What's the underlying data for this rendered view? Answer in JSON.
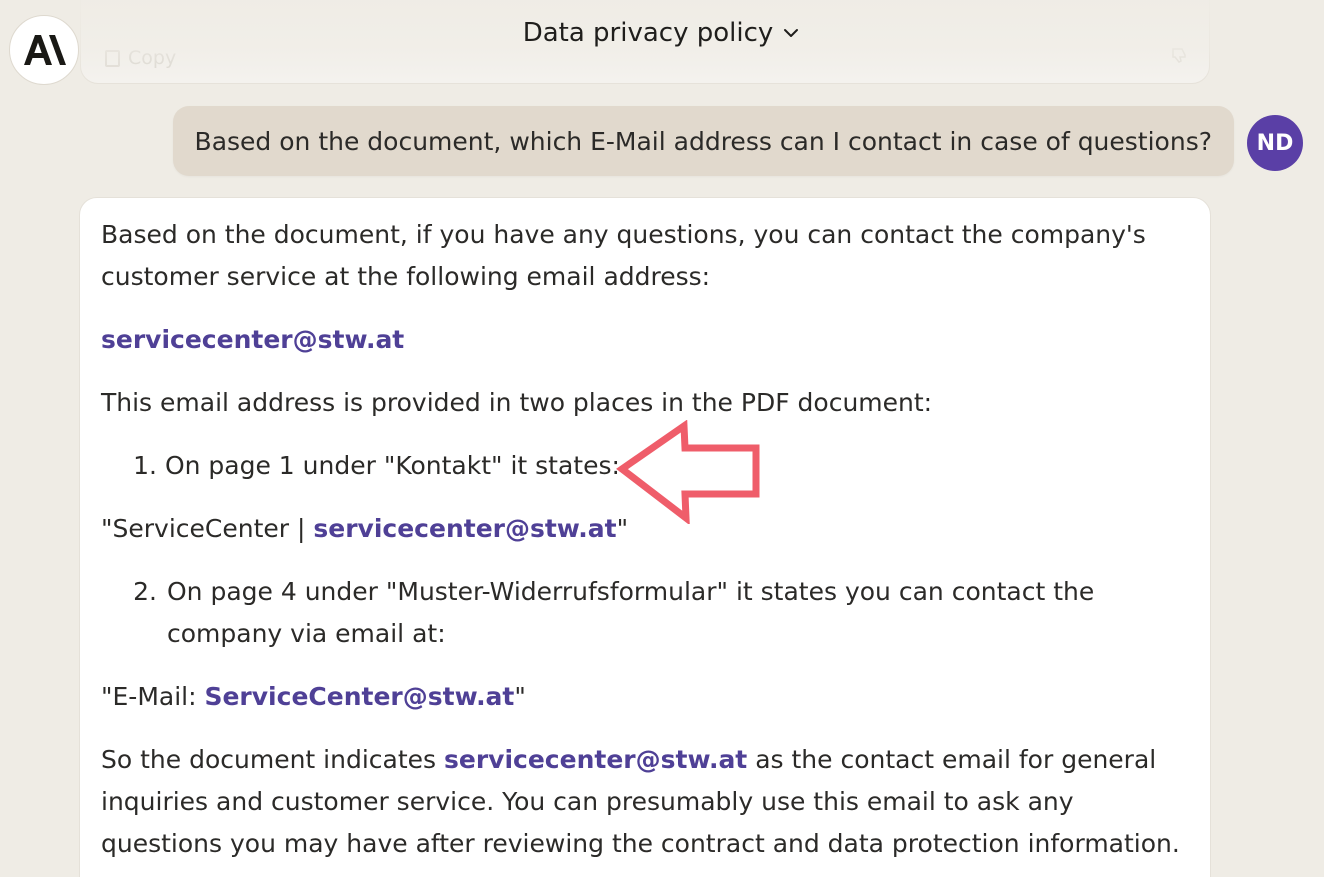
{
  "header": {
    "title": "Data privacy policy"
  },
  "previous_message": {
    "copy_label": "Copy"
  },
  "user": {
    "initials": "ND",
    "message": "Based on the document, which E-Mail address can I contact in case of questions?"
  },
  "reply": {
    "p1": "Based on the document, if you have any questions, you can contact the company's customer service at the following email address:",
    "email_main": "servicecenter@stw.at",
    "p2": "This email address is provided in two places in the PDF document:",
    "item1_num": "1.",
    "item1_text": "On page 1 under \"Kontakt\" it states:",
    "quote1_prefix": "\"ServiceCenter | ",
    "quote1_link": "servicecenter@stw.at",
    "quote1_suffix": "\"",
    "item2_num": "2.",
    "item2_text": "On page 4 under \"Muster-Widerrufsformular\" it states you can contact the company via email at:",
    "quote2_prefix": "\"E-Mail: ",
    "quote2_link": "ServiceCenter@stw.at",
    "quote2_suffix": "\"",
    "p3_before": "So the document indicates ",
    "p3_link": "servicecenter@stw.at",
    "p3_after": " as the contact email for general inquiries and customer service. You can presumably use this email to ask any questions you may have after reviewing the contract and data protection information."
  },
  "colors": {
    "link": "#4f4096",
    "avatar": "#5a3fa6",
    "annotation_arrow": "#ef5d6a",
    "user_bubble": "#e1d9cd",
    "background": "#efece5"
  },
  "icons": {
    "logo": "anthropic-logo",
    "title_chevron": "chevron-down-icon",
    "copy": "copy-icon",
    "thumbs_down": "thumbs-down-icon",
    "annotation": "left-arrow-annotation"
  }
}
